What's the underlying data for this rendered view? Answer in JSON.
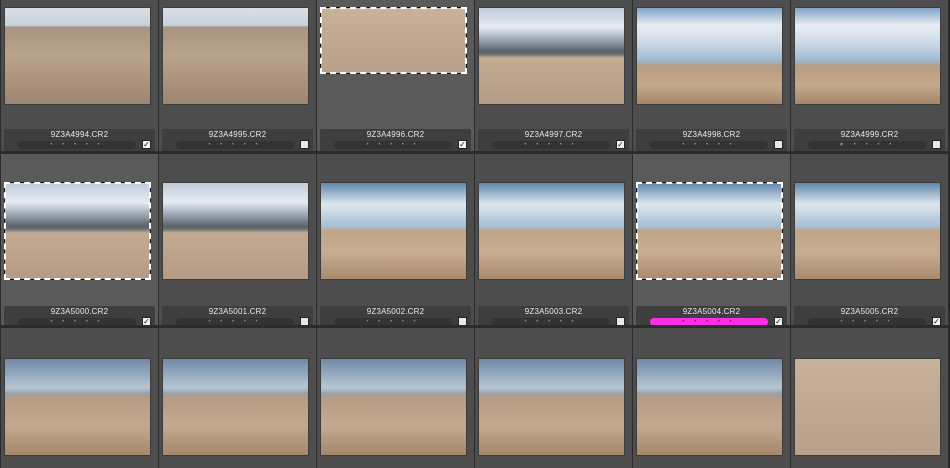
{
  "thumbnails": [
    {
      "filename": "9Z3A4994.CR2",
      "rating": "• • • • •",
      "checked": true,
      "marked": false,
      "scene": "dunes-tall"
    },
    {
      "filename": "9Z3A4995.CR2",
      "rating": "• • • • •",
      "checked": false,
      "marked": false,
      "scene": "dunes-tall"
    },
    {
      "filename": "9Z3A4996.CR2",
      "rating": "• • • • •",
      "checked": true,
      "marked": true,
      "scene": "sand-only"
    },
    {
      "filename": "9Z3A4997.CR2",
      "rating": "• • • • •",
      "checked": true,
      "marked": false,
      "scene": "sky-mountain"
    },
    {
      "filename": "9Z3A4998.CR2",
      "rating": "• • • • •",
      "checked": false,
      "marked": false,
      "scene": "sky-clouds"
    },
    {
      "filename": "9Z3A4999.CR2",
      "rating": "★ • • • •",
      "checked": false,
      "marked": false,
      "scene": "sky-clouds"
    },
    {
      "filename": "9Z3A5000.CR2",
      "rating": "• • • • •",
      "checked": true,
      "marked": true,
      "scene": "sky-mountain"
    },
    {
      "filename": "9Z3A5001.CR2",
      "rating": "• • • • •",
      "checked": false,
      "marked": false,
      "scene": "sky-mountain"
    },
    {
      "filename": "9Z3A5002.CR2",
      "rating": "• • • • •",
      "checked": false,
      "marked": false,
      "scene": "sky-clouds2"
    },
    {
      "filename": "9Z3A5003.CR2",
      "rating": "• • • • •",
      "checked": false,
      "marked": false,
      "scene": "sky-clouds2"
    },
    {
      "filename": "9Z3A5004.CR2",
      "rating": "• • • • •",
      "checked": true,
      "marked": true,
      "scene": "sky-clouds2",
      "label_color": "#ff2ee6"
    },
    {
      "filename": "9Z3A5005.CR2",
      "rating": "• • • • •",
      "checked": true,
      "marked": false,
      "scene": "sky-clouds2"
    },
    {
      "filename": "",
      "rating": "",
      "checked": false,
      "marked": false,
      "scene": "sky-flat"
    },
    {
      "filename": "",
      "rating": "",
      "checked": false,
      "marked": false,
      "scene": "sky-flat"
    },
    {
      "filename": "",
      "rating": "",
      "checked": false,
      "marked": false,
      "scene": "sky-flat"
    },
    {
      "filename": "",
      "rating": "",
      "checked": false,
      "marked": false,
      "scene": "sky-flat"
    },
    {
      "filename": "",
      "rating": "",
      "checked": false,
      "marked": false,
      "scene": "sky-flat"
    },
    {
      "filename": "",
      "rating": "",
      "checked": false,
      "marked": false,
      "scene": "sand-only"
    }
  ],
  "colors": {
    "background": "#2b2b2b",
    "cell": "#4d4d4d",
    "label_magenta": "#ff2ee6"
  }
}
